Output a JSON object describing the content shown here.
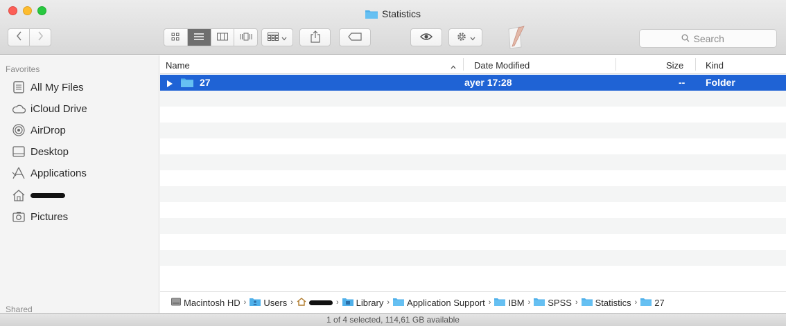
{
  "window": {
    "title": "Statistics"
  },
  "toolbar": {
    "back_icon": "chevron-left-icon",
    "forward_icon": "chevron-right-icon",
    "view_modes": [
      "icon-view-icon",
      "list-view-icon",
      "column-view-icon",
      "cover-flow-icon"
    ],
    "active_view": "list-view-icon",
    "search_placeholder": "Search"
  },
  "sidebar": {
    "favorites_heading": "Favorites",
    "shared_heading": "Shared",
    "items": [
      {
        "label": "All My Files",
        "icon": "all-files-icon"
      },
      {
        "label": "iCloud Drive",
        "icon": "cloud-icon"
      },
      {
        "label": "AirDrop",
        "icon": "airdrop-icon"
      },
      {
        "label": "Desktop",
        "icon": "desktop-icon"
      },
      {
        "label": "Applications",
        "icon": "applications-icon"
      },
      {
        "label": "",
        "icon": "home-icon"
      },
      {
        "label": "Pictures",
        "icon": "camera-icon"
      }
    ]
  },
  "list": {
    "columns": {
      "name": "Name",
      "date": "Date Modified",
      "size": "Size",
      "kind": "Kind"
    },
    "rows": [
      {
        "name": "27",
        "date": "ayer 17:28",
        "size": "--",
        "kind": "Folder",
        "selected": true
      }
    ]
  },
  "pathbar": {
    "items": [
      "Macintosh HD",
      "Users",
      "",
      "Library",
      "Application Support",
      "IBM",
      "SPSS",
      "Statistics",
      "27"
    ],
    "separator": "›"
  },
  "status": {
    "text": "1 of 4 selected, 114,61 GB available"
  },
  "colors": {
    "selection": "#1f63d5",
    "folder": "#4fb0ea"
  }
}
